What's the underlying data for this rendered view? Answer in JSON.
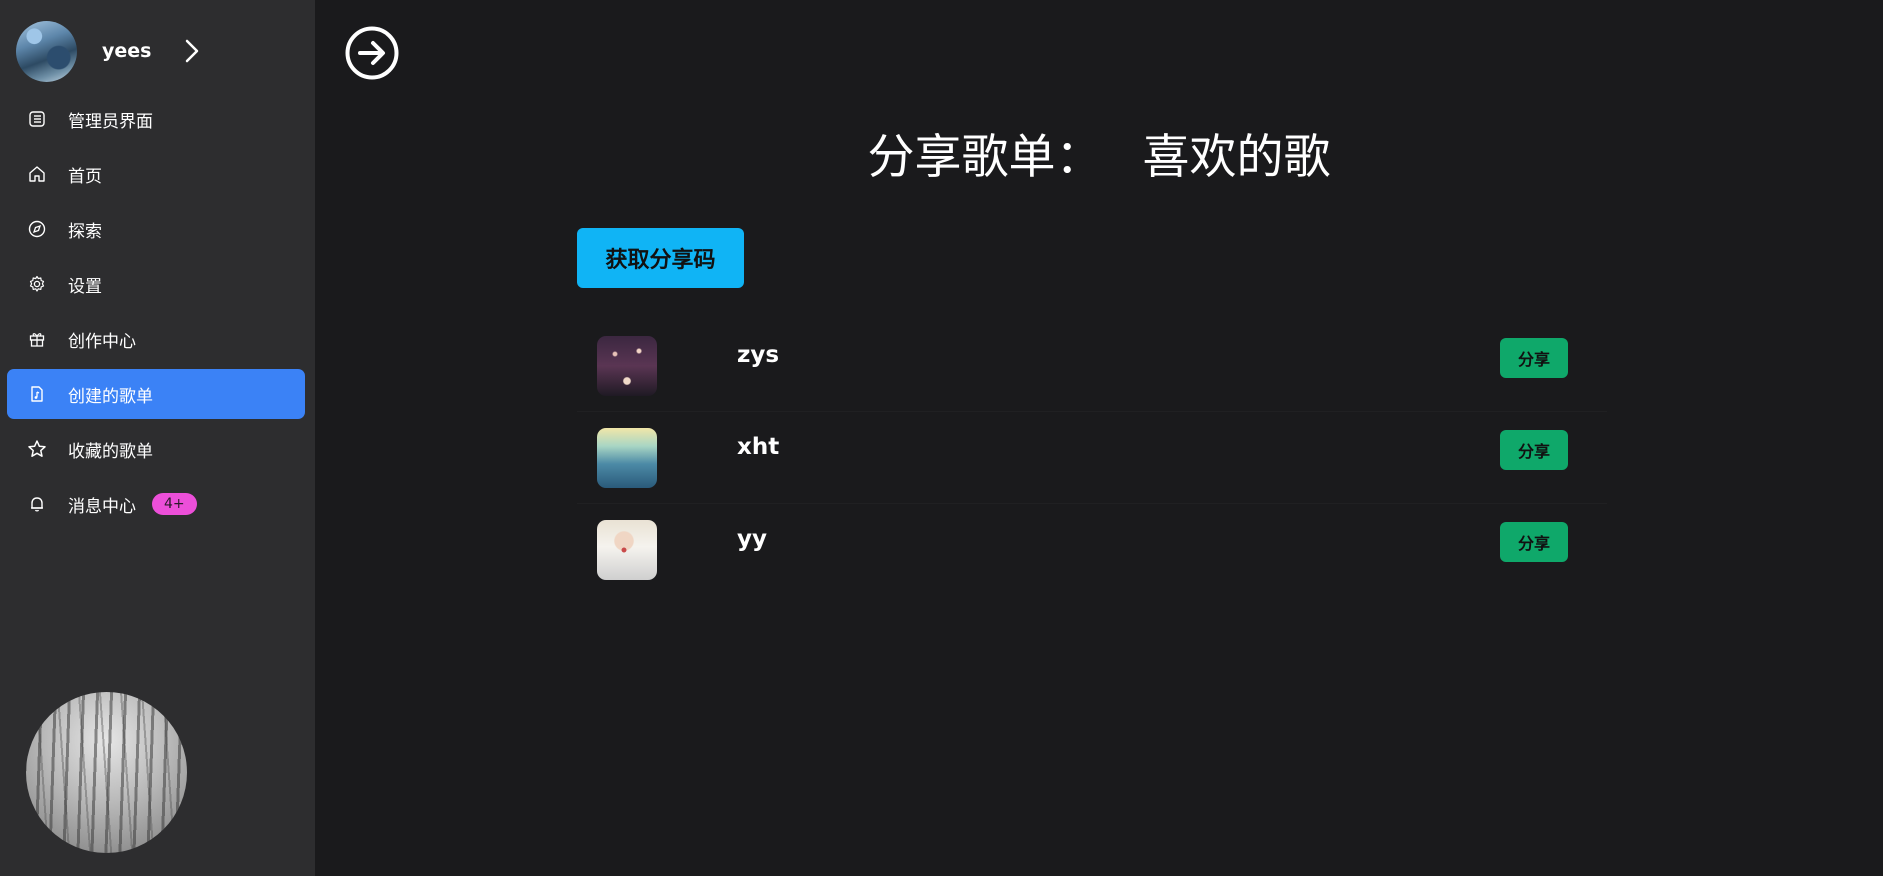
{
  "user": {
    "name": "yees"
  },
  "sidebar": {
    "items": [
      {
        "label": "管理员界面",
        "icon": "admin-list-icon",
        "active": false
      },
      {
        "label": "首页",
        "icon": "home-icon",
        "active": false
      },
      {
        "label": "探索",
        "icon": "compass-icon",
        "active": false
      },
      {
        "label": "设置",
        "icon": "gear-icon",
        "active": false
      },
      {
        "label": "创作中心",
        "icon": "gift-icon",
        "active": false
      },
      {
        "label": "创建的歌单",
        "icon": "music-file-icon",
        "active": true
      },
      {
        "label": "收藏的歌单",
        "icon": "star-icon",
        "active": false
      },
      {
        "label": "消息中心",
        "icon": "bell-icon",
        "active": false,
        "badge": "4+"
      }
    ]
  },
  "main": {
    "title_prefix": "分享歌单：",
    "title_name": "喜欢的歌",
    "share_code_label": "获取分享码",
    "songs": [
      {
        "name": "zys",
        "share_label": "分享"
      },
      {
        "name": "xht",
        "share_label": "分享"
      },
      {
        "name": "yy",
        "share_label": "分享"
      }
    ]
  },
  "colors": {
    "background": "#1a1a1c",
    "sidebar": "#2d2d2f",
    "active_nav": "#3b82f6",
    "share_code_button": "#10b4f5",
    "share_button": "#0fa86a",
    "badge": "#ec4fd9"
  }
}
